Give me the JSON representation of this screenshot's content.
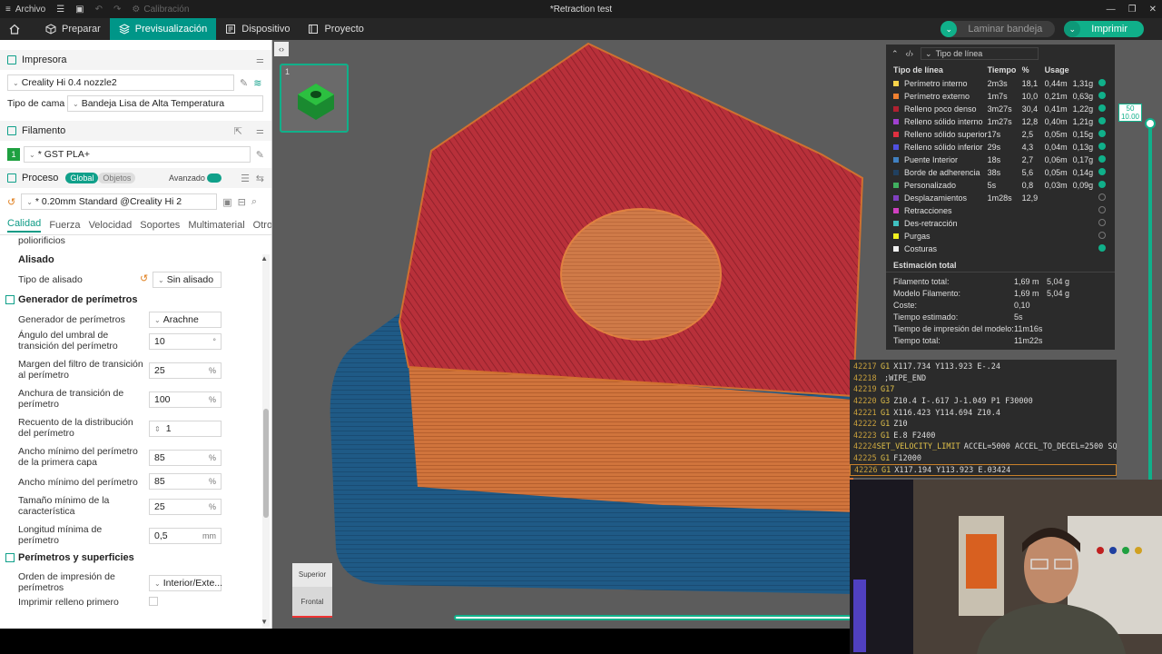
{
  "titlebar": {
    "menu": "Archivo",
    "calibration": "Calibración",
    "title": "*Retraction test"
  },
  "tabs": [
    {
      "label": "Preparar"
    },
    {
      "label": "Previsualización"
    },
    {
      "label": "Dispositivo"
    },
    {
      "label": "Proyecto"
    }
  ],
  "actions": {
    "slice": "Laminar bandeja",
    "print": "Imprimir"
  },
  "printer": {
    "section": "Impresora",
    "name": "Creality Hi 0.4 nozzle2",
    "bed_label": "Tipo de cama",
    "bed_value": "Bandeja Lisa de Alta Temperatura"
  },
  "filament": {
    "section": "Filamento",
    "slot": "1",
    "name": "* GST PLA+"
  },
  "process": {
    "section": "Proceso",
    "global": "Global",
    "objects": "Objetos",
    "advanced": "Avanzado",
    "profile": "* 0.20mm Standard @Creality Hi 2"
  },
  "subtabs": [
    "Calidad",
    "Fuerza",
    "Velocidad",
    "Soportes",
    "Multimaterial",
    "Otros"
  ],
  "settings": {
    "cut_label": "poliorificios",
    "ironing_group": "Alisado",
    "ironing_type_label": "Tipo de alisado",
    "ironing_type_value": "Sin alisado",
    "wall_gen_group": "Generador de perímetros",
    "wall_gen_label": "Generador de perímetros",
    "wall_gen_value": "Arachne",
    "angle_label": "Ángulo del umbral de transición del perímetro",
    "angle_value": "10",
    "angle_unit": "°",
    "margin_label": "Margen del filtro de transición al perímetro",
    "margin_value": "25",
    "margin_unit": "%",
    "width_label": "Anchura de transición de perímetro",
    "width_value": "100",
    "width_unit": "%",
    "count_label": "Recuento de la distribución del perímetro",
    "count_value": "1",
    "first_min_label": "Ancho mínimo del perímetro de la primera capa",
    "first_min_value": "85",
    "first_min_unit": "%",
    "min_label": "Ancho mínimo del perímetro",
    "min_value": "85",
    "min_unit": "%",
    "feature_label": "Tamaño mínimo de la característica",
    "feature_value": "25",
    "feature_unit": "%",
    "length_label": "Longitud mínima de perímetro",
    "length_value": "0,5",
    "length_unit": "mm",
    "walls_group": "Perímetros y superficies",
    "order_label": "Orden de impresión de perímetros",
    "order_value": "Interior/Exte...",
    "infill_first_label": "Imprimir relleno primero"
  },
  "thumb": {
    "number": "1"
  },
  "stats": {
    "dropdown": "Tipo de línea",
    "headers": [
      "Tipo de línea",
      "Tiempo",
      "%",
      "Usage"
    ],
    "rows": [
      {
        "name": "Perímetro interno",
        "time": "2m3s",
        "pct": "18,1",
        "len": "0,44m",
        "w": "1,31g",
        "color": "#f7d24a",
        "vis": true
      },
      {
        "name": "Perímetro externo",
        "time": "1m7s",
        "pct": "10,0",
        "len": "0,21m",
        "w": "0,63g",
        "color": "#f08030",
        "vis": true
      },
      {
        "name": "Relleno poco denso",
        "time": "3m27s",
        "pct": "30,4",
        "len": "0,41m",
        "w": "1,22g",
        "color": "#b02030",
        "vis": true
      },
      {
        "name": "Relleno sólido interno",
        "time": "1m27s",
        "pct": "12,8",
        "len": "0,40m",
        "w": "1,21g",
        "color": "#a040d0",
        "vis": true
      },
      {
        "name": "Relleno sólido superior",
        "time": "17s",
        "pct": "2,5",
        "len": "0,05m",
        "w": "0,15g",
        "color": "#e03040",
        "vis": true
      },
      {
        "name": "Relleno sólido inferior",
        "time": "29s",
        "pct": "4,3",
        "len": "0,04m",
        "w": "0,13g",
        "color": "#5050e0",
        "vis": true
      },
      {
        "name": "Puente Interior",
        "time": "18s",
        "pct": "2,7",
        "len": "0,06m",
        "w": "0,17g",
        "color": "#4080c0",
        "vis": true
      },
      {
        "name": "Borde de adherencia",
        "time": "38s",
        "pct": "5,6",
        "len": "0,05m",
        "w": "0,14g",
        "color": "#204060",
        "vis": true
      },
      {
        "name": "Personalizado",
        "time": "5s",
        "pct": "0,8",
        "len": "0,03m",
        "w": "0,09g",
        "color": "#40b060",
        "vis": true
      },
      {
        "name": "Desplazamientos",
        "time": "1m28s",
        "pct": "12,9",
        "len": "",
        "w": "",
        "color": "#8040c0",
        "vis": false
      },
      {
        "name": "Retracciones",
        "time": "",
        "pct": "",
        "len": "",
        "w": "",
        "color": "#d040c0",
        "vis": false
      },
      {
        "name": "Des-retracción",
        "time": "",
        "pct": "",
        "len": "",
        "w": "",
        "color": "#40c0c0",
        "vis": false
      },
      {
        "name": "Purgas",
        "time": "",
        "pct": "",
        "len": "",
        "w": "",
        "color": "#f0f020",
        "vis": false
      },
      {
        "name": "Costuras",
        "time": "",
        "pct": "",
        "len": "",
        "w": "",
        "color": "#f0f0f0",
        "vis": true
      }
    ],
    "total_title": "Estimación total",
    "totals": [
      {
        "k": "Filamento total:",
        "v1": "1,69 m",
        "v2": "5,04 g"
      },
      {
        "k": "Modelo Filamento:",
        "v1": "1,69 m",
        "v2": "5,04 g"
      },
      {
        "k": "Coste:",
        "v1": "0,10",
        "v2": ""
      },
      {
        "k": "Tiempo estimado:",
        "v1": "5s",
        "v2": ""
      },
      {
        "k": "Tiempo de impresión del modelo:",
        "v1": "11m16s",
        "v2": ""
      },
      {
        "k": "Tiempo total:",
        "v1": "11m22s",
        "v2": ""
      }
    ]
  },
  "gcode": [
    {
      "n": "42217",
      "cmd": "G1",
      "args": "X117.734 Y113.923 E-.24"
    },
    {
      "n": "42218",
      "cmd": "",
      "args": ";WIPE_END"
    },
    {
      "n": "42219",
      "cmd": "G17",
      "args": ""
    },
    {
      "n": "42220",
      "cmd": "G3",
      "args": "Z10.4 I-.617 J-1.049 P1 F30000"
    },
    {
      "n": "42221",
      "cmd": "G1",
      "args": "X116.423 Y114.694 Z10.4"
    },
    {
      "n": "42222",
      "cmd": "G1",
      "args": "Z10"
    },
    {
      "n": "42223",
      "cmd": "G1",
      "args": "E.8 F2400"
    },
    {
      "n": "42224",
      "cmd": "SET_VELOCITY_LIMIT",
      "args": "ACCEL=5000 ACCEL_TO_DECEL=2500 SQ..."
    },
    {
      "n": "42225",
      "cmd": "G1",
      "args": "F12000"
    },
    {
      "n": "42226",
      "cmd": "G1",
      "args": "X117.194 Y113.923 E.03424"
    }
  ],
  "layer": {
    "top": "50",
    "height": "10.00"
  },
  "navcube": {
    "top": "Superior",
    "front": "Frontal"
  }
}
